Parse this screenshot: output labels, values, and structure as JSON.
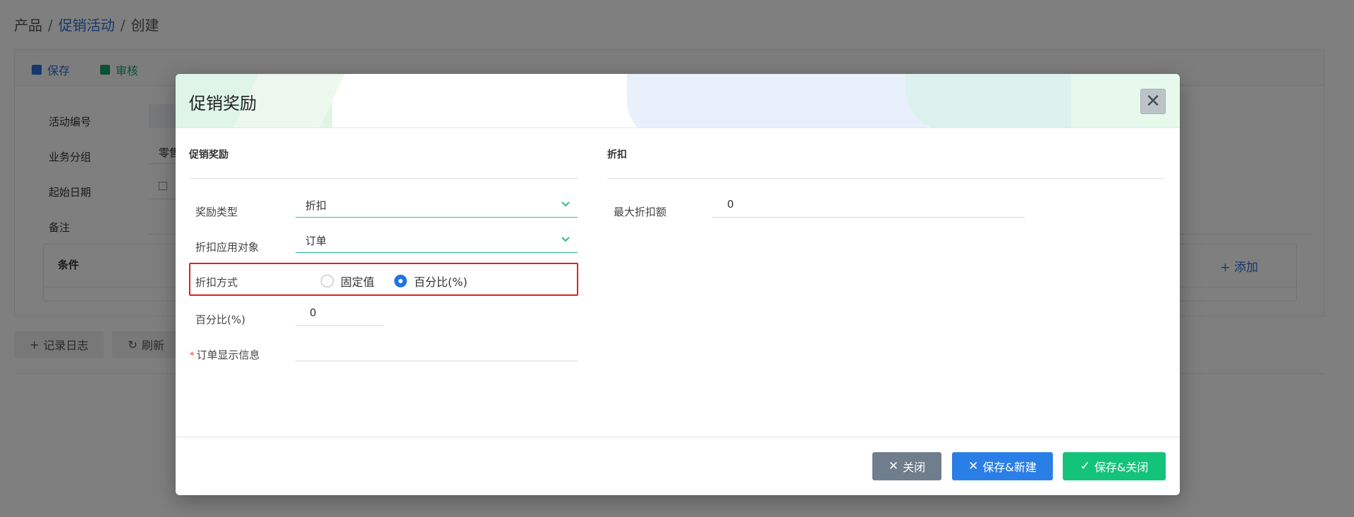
{
  "breadcrumb": {
    "root": "产品",
    "sep": "/",
    "parent": "促销活动",
    "current": "创建"
  },
  "toolbar": {
    "save_label": "保存",
    "audit_label": "审核"
  },
  "background_form": {
    "activity_no_label": "活动编号",
    "business_group_label": "业务分组",
    "business_group_value": "零售",
    "start_date_label": "起始日期",
    "note_label": "备注",
    "conditions_title": "条件",
    "add_label": "添加"
  },
  "bottom_actions": {
    "log_label": "记录日志",
    "refresh_label": "刷新"
  },
  "modal": {
    "title": "促销奖励",
    "close_symbol": "✕",
    "left_section_title": "促销奖励",
    "right_section_title": "折扣",
    "reward_type": {
      "label": "奖励类型",
      "value": "折扣"
    },
    "apply_target": {
      "label": "折扣应用对象",
      "value": "订单"
    },
    "discount_method": {
      "label": "折扣方式",
      "options": [
        {
          "label": "固定值",
          "selected": false
        },
        {
          "label": "百分比(%)",
          "selected": true
        }
      ]
    },
    "percentage": {
      "label": "百分比(%)",
      "value": "0"
    },
    "order_display_info": {
      "label": "订单显示信息",
      "required_mark": "*",
      "value": ""
    },
    "max_discount": {
      "label": "最大折扣额",
      "value": "0"
    },
    "buttons": {
      "close": "关闭",
      "save_new": "保存&新建",
      "save_close": "保存&关闭"
    }
  },
  "colors": {
    "primary": "#2a7fe6",
    "success": "#14c37a",
    "neutral": "#707d8c",
    "highlight": "#e32020",
    "accent_green": "#2dbd84"
  }
}
